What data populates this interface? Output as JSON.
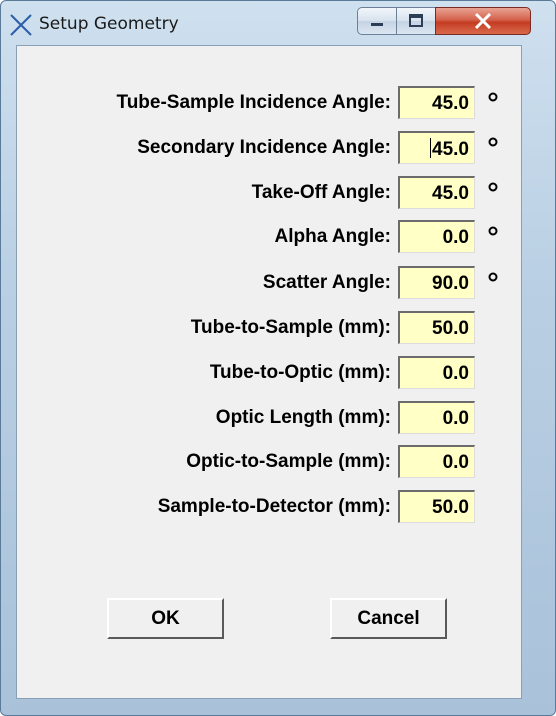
{
  "window": {
    "title": "Setup Geometry"
  },
  "fields": [
    {
      "label": "Tube-Sample Incidence Angle:",
      "value": "45.0",
      "unit": "°"
    },
    {
      "label": "Secondary Incidence Angle:",
      "value": "45.0",
      "unit": "°"
    },
    {
      "label": "Take-Off Angle:",
      "value": "45.0",
      "unit": "°"
    },
    {
      "label": "Alpha Angle:",
      "value": "0.0",
      "unit": "°"
    },
    {
      "label": "Scatter Angle:",
      "value": "90.0",
      "unit": "°"
    },
    {
      "label": "Tube-to-Sample (mm):",
      "value": "50.0"
    },
    {
      "label": "Tube-to-Optic (mm):",
      "value": "0.0"
    },
    {
      "label": "Optic Length (mm):",
      "value": "0.0"
    },
    {
      "label": "Optic-to-Sample (mm):",
      "value": "0.0"
    },
    {
      "label": "Sample-to-Detector (mm):",
      "value": "50.0"
    }
  ],
  "buttons": {
    "ok": "OK",
    "cancel": "Cancel"
  },
  "colors": {
    "field_bg": "#ffffc6",
    "close_button": "#c43c22"
  }
}
